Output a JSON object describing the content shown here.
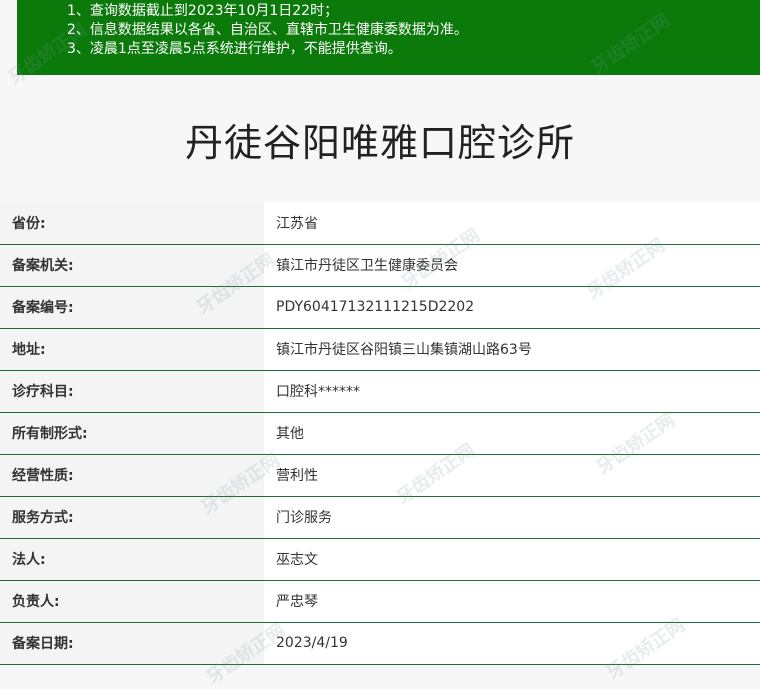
{
  "notice": {
    "lines": [
      "1、查询数据截止到2023年10月1日22时；",
      "2、信息数据结果以各省、自治区、直辖市卫生健康委数据为准。",
      "3、凌晨1点至凌晨5点系统进行维护，不能提供查询。"
    ]
  },
  "page_title": "丹徒谷阳唯雅口腔诊所",
  "rows": [
    {
      "key": "省份:",
      "value": "江苏省"
    },
    {
      "key": "备案机关:",
      "value": "镇江市丹徒区卫生健康委员会"
    },
    {
      "key": "备案编号:",
      "value": "PDY60417132111215D2202"
    },
    {
      "key": "地址:",
      "value": "镇江市丹徒区谷阳镇三山集镇湖山路63号"
    },
    {
      "key": "诊疗科目:",
      "value": "口腔科******"
    },
    {
      "key": "所有制形式:",
      "value": "其他"
    },
    {
      "key": "经营性质:",
      "value": "营利性"
    },
    {
      "key": "服务方式:",
      "value": "门诊服务"
    },
    {
      "key": "法人:",
      "value": "巫志文"
    },
    {
      "key": "负责人:",
      "value": "严忠琴"
    },
    {
      "key": "备案日期:",
      "value": "2023/4/19"
    }
  ],
  "watermark": "牙齿矫正网"
}
